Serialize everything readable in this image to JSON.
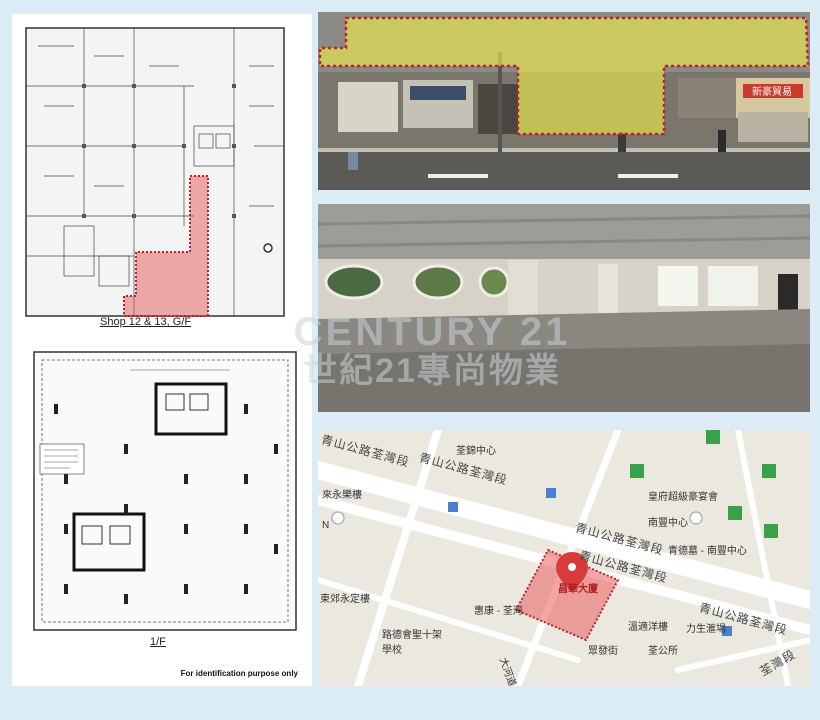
{
  "left_panel": {
    "caption_gf": "Shop 12 & 13, G/F",
    "caption_1f": "1/F",
    "note": "For identification purpose only"
  },
  "watermark": {
    "line1": "CENTURY 21",
    "line2": "世紀21專尚物業"
  },
  "street_photo": {
    "sign_text": "新豪貿易"
  },
  "map": {
    "road_labels": [
      "青山公路荃灣段",
      "青山公路荃灣段",
      "青山公路荃灣段",
      "青山公路荃灣段",
      "青山公路荃灣段",
      "荃灣段"
    ],
    "labels": {
      "tsuen_wan_centre": "荃錦中心",
      "restaurant": "皇府超級豪宴會",
      "nanfung_centre": "南豐中心",
      "nanfung_sub": "青德墓 - 南豐中心",
      "wing_tak": "來永樂樓",
      "n_label": "N",
      "kwok_wing": "東郊永定樓",
      "target": "昌華大廈",
      "huituan": "惠康 - 荃灣",
      "laiyuen": "溫適洋樓",
      "lixing": "力生滙場",
      "tsuen_kung": "荃公所",
      "school": "路德會聖十架學校",
      "ping_fat": "眾發街",
      "tai_ho": "大河道"
    },
    "colors": {
      "highlight": "#e85c5c",
      "pin": "#d93a3a",
      "poi_green": "#3aa04a",
      "poi_blue": "#4a7fd1"
    }
  },
  "colors": {
    "background": "#dcecf7",
    "highlight_red": "#e24a4a",
    "highlight_yellow": "#f3f24a"
  }
}
